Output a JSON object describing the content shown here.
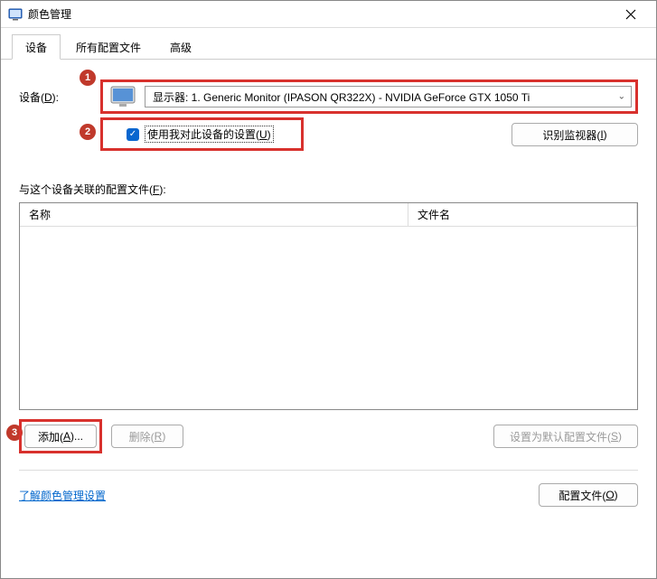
{
  "window": {
    "title": "颜色管理"
  },
  "tabs": {
    "device": "设备",
    "allProfiles": "所有配置文件",
    "advanced": "高级"
  },
  "labels": {
    "device": "设备(D):",
    "useMySettings": "使用我对此设备的设置(U)",
    "identifyMonitors": "识别监视器(I)",
    "associatedProfiles": "与这个设备关联的配置文件(F):",
    "colName": "名称",
    "colFile": "文件名",
    "add": "添加(A)...",
    "remove": "删除(R)",
    "setDefault": "设置为默认配置文件(S)",
    "learnLink": "了解颜色管理设置",
    "profilesBtn": "配置文件(O)"
  },
  "device": {
    "selected": "显示器: 1. Generic Monitor (IPASON QR322X) - NVIDIA GeForce GTX 1050 Ti"
  },
  "annotations": {
    "a1": "1",
    "a2": "2",
    "a3": "3"
  }
}
